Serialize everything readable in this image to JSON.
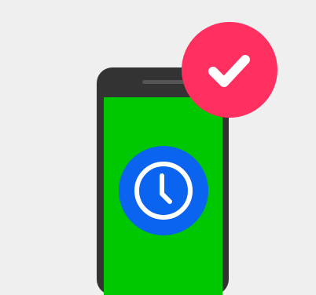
{
  "illustration": {
    "phone_icon": "smartphone-icon",
    "screen_icon": "clock-icon",
    "badge_icon": "checkmark-icon"
  },
  "colors": {
    "background": "#efefef",
    "phone_body": "#333333",
    "screen": "#00c800",
    "clock_badge": "#0a64ef",
    "check_badge": "#ff2f5f",
    "icon_stroke": "#ffffff"
  }
}
